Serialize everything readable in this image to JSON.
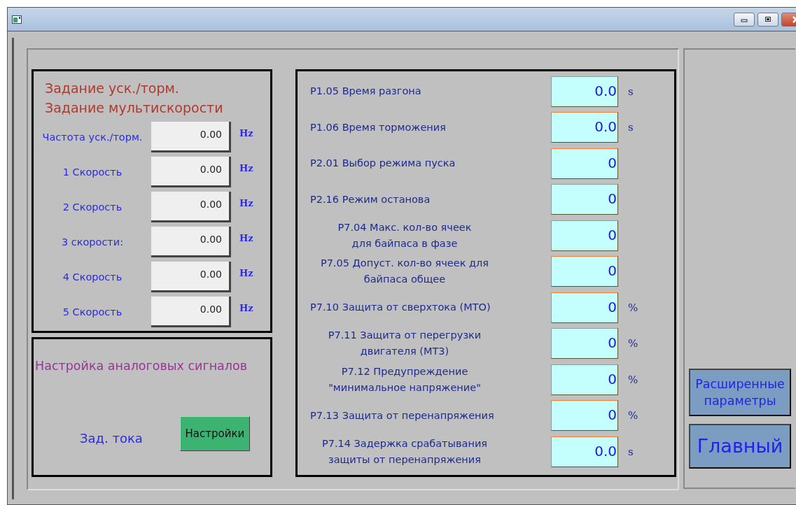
{
  "window": {
    "buttons": [
      {
        "kind": "minimize"
      },
      {
        "kind": "maximize"
      },
      {
        "kind": "close"
      }
    ]
  },
  "accel_panel": {
    "title_lines": [
      "Задание уск./торм.",
      "Задание мультискорости"
    ],
    "rows": [
      {
        "label": "Частота уск./торм.",
        "value": "0.00",
        "unit": "Hz"
      },
      {
        "label": "1 Скорость",
        "value": "0.00",
        "unit": "Hz"
      },
      {
        "label": "2 Скорость",
        "value": "0.00",
        "unit": "Hz"
      },
      {
        "label": "3 скорости:",
        "value": "0.00",
        "unit": "Hz"
      },
      {
        "label": "4 Скорость",
        "value": "0.00",
        "unit": "Hz"
      },
      {
        "label": "5 Скорость",
        "value": "0.00",
        "unit": "Hz"
      }
    ]
  },
  "analog_panel": {
    "title": "Настройка аналоговых сигналов",
    "label": "Зад. тока",
    "button": "Настройки"
  },
  "parameters": [
    {
      "label": "P1.05 Время разгона",
      "value": "0.0",
      "unit": "s"
    },
    {
      "label": "P1.06 Время торможения",
      "value": "0.0",
      "unit": "s"
    },
    {
      "label": "P2.01 Выбор режима пуска",
      "value": "0"
    },
    {
      "label": "P2.16 Режим останова",
      "value": "0"
    },
    {
      "label": "P7.04 Макс. кол-во ячеек\nдля байпаса в фазе",
      "value": "0"
    },
    {
      "label": "P7.05 Допуст. кол-во ячеек для\nбайпаса общее",
      "value": "0"
    },
    {
      "label": "P7.10 Защита от сверхтока (MTO)",
      "value": "0",
      "unit": "%"
    },
    {
      "label": "P7.11 Защита от перегрузки\nдвигателя (MT3)",
      "value": "0",
      "unit": "%"
    },
    {
      "label": "P7.12 Предупреждение\n\"минимальное напряжение\"",
      "value": "0",
      "unit": "%"
    },
    {
      "label": "P7.13 Защита от перенапряжения",
      "value": "0",
      "unit": "%"
    },
    {
      "label": "P7.14 Задержка срабатывания\nзащиты от перенапряжения",
      "value": "0.0",
      "unit": "s"
    }
  ],
  "nav_buttons": [
    "Расширенные параметры",
    "Главный"
  ]
}
